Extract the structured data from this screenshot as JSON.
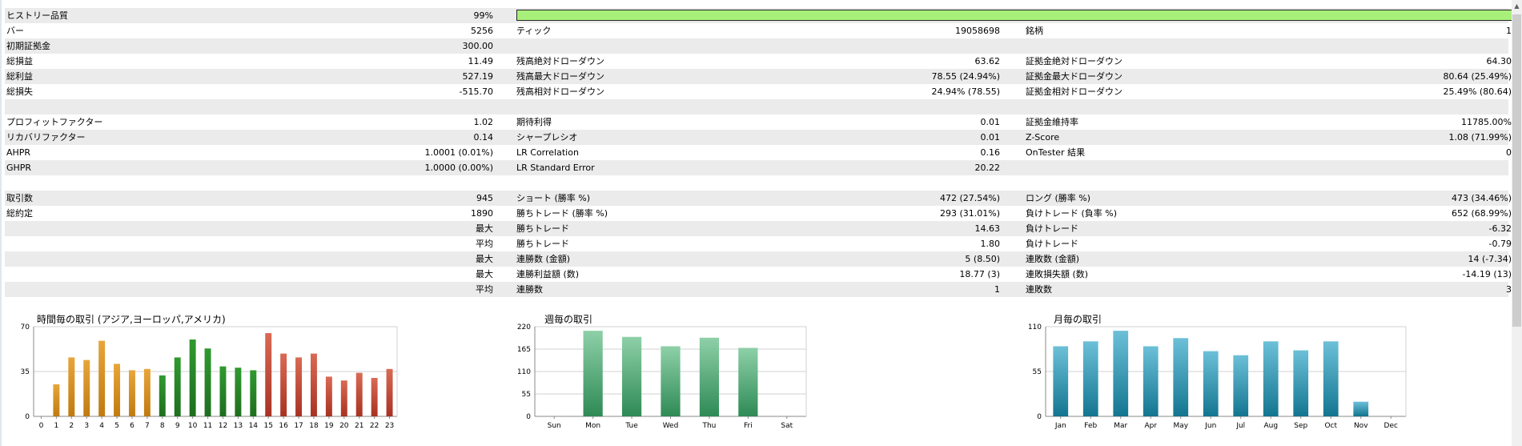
{
  "report": {
    "history_quality": {
      "label": "ヒストリー品質",
      "value": "99%"
    },
    "rows": [
      [
        [
          "バー",
          "5256"
        ],
        [
          "ティック",
          "19058698"
        ],
        [
          "銘柄",
          "1"
        ]
      ],
      [
        [
          "初期証拠金",
          "300.00"
        ],
        [
          "",
          ""
        ],
        [
          "",
          ""
        ]
      ],
      [
        [
          "総損益",
          "11.49"
        ],
        [
          "残高絶対ドローダウン",
          "63.62"
        ],
        [
          "証拠金絶対ドローダウン",
          "64.30"
        ]
      ],
      [
        [
          "総利益",
          "527.19"
        ],
        [
          "残高最大ドローダウン",
          "78.55 (24.94%)"
        ],
        [
          "証拠金最大ドローダウン",
          "80.64 (25.49%)"
        ]
      ],
      [
        [
          "総損失",
          "-515.70"
        ],
        [
          "残高相対ドローダウン",
          "24.94% (78.55)"
        ],
        [
          "証拠金相対ドローダウン",
          "25.49% (80.64)"
        ]
      ],
      [
        [
          "",
          ""
        ],
        [
          "",
          ""
        ],
        [
          "",
          ""
        ]
      ],
      [
        [
          "プロフィットファクター",
          "1.02"
        ],
        [
          "期待利得",
          "0.01"
        ],
        [
          "証拠金維持率",
          "11785.00%"
        ]
      ],
      [
        [
          "リカバリファクター",
          "0.14"
        ],
        [
          "シャープレシオ",
          "0.01"
        ],
        [
          "Z-Score",
          "1.08 (71.99%)"
        ]
      ],
      [
        [
          "AHPR",
          "1.0001 (0.01%)"
        ],
        [
          "LR Correlation",
          "0.16"
        ],
        [
          "OnTester 結果",
          "0"
        ]
      ],
      [
        [
          "GHPR",
          "1.0000 (0.00%)"
        ],
        [
          "LR Standard Error",
          "20.22"
        ],
        [
          "",
          ""
        ]
      ],
      [
        [
          "",
          ""
        ],
        [
          "",
          ""
        ],
        [
          "",
          ""
        ]
      ],
      [
        [
          "取引数",
          "945"
        ],
        [
          "ショート (勝率 %)",
          "472 (27.54%)"
        ],
        [
          "ロング (勝率 %)",
          "473 (34.46%)"
        ]
      ],
      [
        [
          "総約定",
          "1890"
        ],
        [
          "勝ちトレード (勝率 %)",
          "293 (31.01%)"
        ],
        [
          "負けトレード (負率 %)",
          "652 (68.99%)"
        ]
      ],
      [
        [
          "",
          "最大"
        ],
        [
          "勝ちトレード",
          "14.63"
        ],
        [
          "負けトレード",
          "-6.32"
        ]
      ],
      [
        [
          "",
          "平均"
        ],
        [
          "勝ちトレード",
          "1.80"
        ],
        [
          "負けトレード",
          "-0.79"
        ]
      ],
      [
        [
          "",
          "最大"
        ],
        [
          "連勝数 (金額)",
          "5 (8.50)"
        ],
        [
          "連敗数 (金額)",
          "14 (-7.34)"
        ]
      ],
      [
        [
          "",
          "最大"
        ],
        [
          "連勝利益額 (数)",
          "18.77 (3)"
        ],
        [
          "連敗損失額 (数)",
          "-14.19 (13)"
        ]
      ],
      [
        [
          "",
          "平均"
        ],
        [
          "連勝数",
          "1"
        ],
        [
          "連敗数",
          "3"
        ]
      ],
      [
        [
          "",
          ""
        ],
        [
          "",
          ""
        ],
        [
          "",
          ""
        ]
      ]
    ]
  },
  "chart_data": [
    {
      "type": "bar",
      "title": "時間毎の取引 (アジア,ヨーロッパ,アメリカ)",
      "categories": [
        "0",
        "1",
        "2",
        "3",
        "4",
        "5",
        "6",
        "7",
        "8",
        "9",
        "10",
        "11",
        "12",
        "13",
        "14",
        "15",
        "16",
        "17",
        "18",
        "19",
        "20",
        "21",
        "22",
        "23"
      ],
      "values": [
        0,
        25,
        46,
        44,
        59,
        41,
        36,
        37,
        32,
        46,
        60,
        53,
        39,
        38,
        36,
        65,
        49,
        46,
        49,
        31,
        28,
        34,
        30,
        37
      ],
      "ylim": [
        0,
        70
      ],
      "yticks": [
        "0",
        "35",
        "70"
      ],
      "colors": [
        "#e8a53a",
        "#e8a53a",
        "#e8a53a",
        "#e8a53a",
        "#e8a53a",
        "#e8a53a",
        "#e8a53a",
        "#e8a53a",
        "#2f9a2f",
        "#2f9a2f",
        "#2f9a2f",
        "#2f9a2f",
        "#2f9a2f",
        "#2f9a2f",
        "#2f9a2f",
        "#d96a55",
        "#d96a55",
        "#d96a55",
        "#d96a55",
        "#d96a55",
        "#d96a55",
        "#d96a55",
        "#d96a55",
        "#d96a55"
      ],
      "colors_dark": [
        "#c07a10",
        "#c07a10",
        "#c07a10",
        "#c07a10",
        "#c07a10",
        "#c07a10",
        "#c07a10",
        "#c07a10",
        "#1e6e1e",
        "#1e6e1e",
        "#1e6e1e",
        "#1e6e1e",
        "#1e6e1e",
        "#1e6e1e",
        "#1e6e1e",
        "#a83222",
        "#a83222",
        "#a83222",
        "#a83222",
        "#a83222",
        "#a83222",
        "#a83222",
        "#a83222",
        "#a83222"
      ]
    },
    {
      "type": "bar",
      "title": "週毎の取引",
      "categories": [
        "Sun",
        "Mon",
        "Tue",
        "Wed",
        "Thu",
        "Fri",
        "Sat"
      ],
      "values": [
        0,
        210,
        195,
        172,
        193,
        168,
        0
      ],
      "ylim": [
        0,
        220
      ],
      "yticks": [
        "0",
        "55",
        "110",
        "165",
        "220"
      ],
      "colors": [
        "#8ed0a8",
        "#8ed0a8",
        "#8ed0a8",
        "#8ed0a8",
        "#8ed0a8",
        "#8ed0a8",
        "#8ed0a8"
      ],
      "colors_dark": [
        "#2e8a55",
        "#2e8a55",
        "#2e8a55",
        "#2e8a55",
        "#2e8a55",
        "#2e8a55",
        "#2e8a55"
      ]
    },
    {
      "type": "bar",
      "title": "月毎の取引",
      "categories": [
        "Jan",
        "Feb",
        "Mar",
        "Apr",
        "May",
        "Jun",
        "Jul",
        "Aug",
        "Sep",
        "Oct",
        "Nov",
        "Dec"
      ],
      "values": [
        86,
        92,
        105,
        86,
        96,
        80,
        75,
        92,
        81,
        92,
        18,
        0
      ],
      "ylim": [
        0,
        110
      ],
      "yticks": [
        "0",
        "55",
        "110"
      ],
      "colors": [
        "#6cc0d8",
        "#6cc0d8",
        "#6cc0d8",
        "#6cc0d8",
        "#6cc0d8",
        "#6cc0d8",
        "#6cc0d8",
        "#6cc0d8",
        "#6cc0d8",
        "#6cc0d8",
        "#6cc0d8",
        "#6cc0d8"
      ],
      "colors_dark": [
        "#137590",
        "#137590",
        "#137590",
        "#137590",
        "#137590",
        "#137590",
        "#137590",
        "#137590",
        "#137590",
        "#137590",
        "#137590",
        "#137590"
      ]
    }
  ]
}
